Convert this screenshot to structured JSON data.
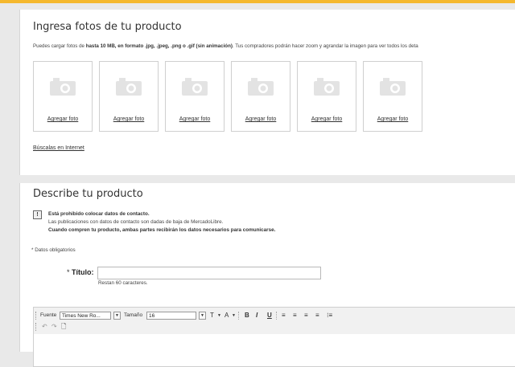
{
  "photos": {
    "title": "Ingresa fotos de tu producto",
    "desc_pre": "Puedes cargar fotos de ",
    "desc_bold": "hasta 10 MB, en formato .jpg, .jpeg, .png o .gif (sin animación)",
    "desc_post": ". Tus compradores podrán hacer zoom y agrandar la imagen para ver todos los deta",
    "add_photo_label": "Agregar foto",
    "search_link": "Búscalas en Internet"
  },
  "describe": {
    "title": "Describe tu producto",
    "warning_icon": "!",
    "warning_line1": "Está prohibido colocar datos de contacto.",
    "warning_line2": "Las publicaciones con datos de contacto son dadas de baja de MercadoLibre.",
    "warning_line3": "Cuando compren tu producto, ambas partes recibirán los datos necesarios para comunicarse.",
    "required_note": "* Datos obligatorios",
    "title_label_star": "* ",
    "title_label": "Título:",
    "title_value": "",
    "title_remaining": "Restan 60 caracteres."
  },
  "toolbar": {
    "font_label": "Fuente",
    "font_value": "Times New Ro...",
    "size_label": "Tamaño",
    "size_value": "16",
    "dd_glyph": "▼",
    "text_color_glyph": "T",
    "bg_color_glyph": "A",
    "bold": "B",
    "italic": "I",
    "underline": "U",
    "align_left": "≡",
    "align_center": "≡",
    "align_right": "≡",
    "justify": "≡",
    "bullets": "⁝≡",
    "undo": "↶",
    "redo": "↷",
    "new_doc": "🗋"
  },
  "colors": {
    "accent": "#f5b82e",
    "page_bg": "#e9e9e9"
  },
  "icons": [
    "camera-icon",
    "warning-icon",
    "undo-icon",
    "redo-icon",
    "new-document-icon"
  ]
}
